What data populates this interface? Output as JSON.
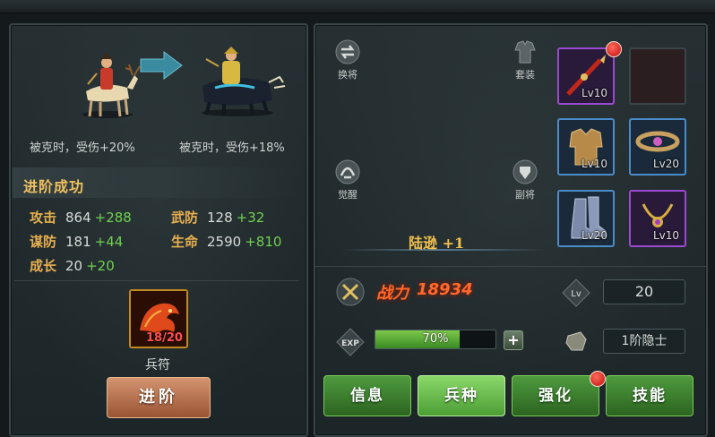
{
  "left": {
    "before_caption": "被克时，受伤+20%",
    "after_caption": "被克时，受伤+18%",
    "section_title": "进阶成功",
    "stats": {
      "attack": {
        "label": "攻击",
        "value": "864",
        "bonus": "+288"
      },
      "martial_def": {
        "label": "武防",
        "value": "128",
        "bonus": "+32"
      },
      "strategy_def": {
        "label": "谋防",
        "value": "181",
        "bonus": "+44"
      },
      "hp": {
        "label": "生命",
        "value": "2590",
        "bonus": "+810"
      },
      "growth": {
        "label": "成长",
        "value": "20",
        "bonus": "+20"
      }
    },
    "token": {
      "count": "18/20",
      "name": "兵符"
    },
    "advance_button": "进阶"
  },
  "right": {
    "side_buttons": {
      "swap": "换将",
      "set": "套装",
      "awaken": "觉醒",
      "deputy": "副将"
    },
    "hero_name": "陆逊 +1",
    "equipment": [
      {
        "level": "Lv10",
        "rarity": "purple",
        "icon": "red-spear-icon",
        "alert": true
      },
      {
        "level": "",
        "rarity": "empty",
        "icon": "empty-slot"
      },
      {
        "level": "Lv10",
        "rarity": "blue",
        "icon": "armor-icon"
      },
      {
        "level": "Lv20",
        "rarity": "blue",
        "icon": "belt-icon"
      },
      {
        "level": "Lv20",
        "rarity": "blue",
        "icon": "boots-icon"
      },
      {
        "level": "Lv10",
        "rarity": "purple",
        "icon": "necklace-icon"
      }
    ],
    "power_label": "战力",
    "power_value": "18934",
    "level_badge": "Lv",
    "level_value": "20",
    "exp_label": "EXP",
    "exp_percent": 70,
    "exp_text": "70%",
    "exp_plus": "+",
    "rank": "1阶隐士",
    "tabs": [
      {
        "label": "信息",
        "active": false,
        "alert": false
      },
      {
        "label": "兵种",
        "active": true,
        "alert": false
      },
      {
        "label": "强化",
        "active": false,
        "alert": true
      },
      {
        "label": "技能",
        "active": false,
        "alert": false
      }
    ]
  },
  "colors": {
    "gold_label": "#f0c060",
    "bonus_green": "#70d050",
    "power_orange": "#ff6a2a",
    "tab_green": "#4e9a3e"
  }
}
